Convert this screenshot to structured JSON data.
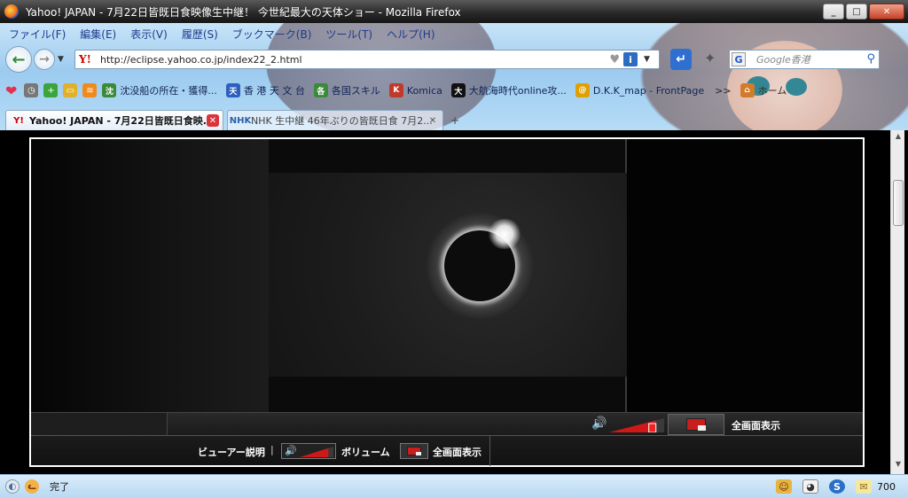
{
  "window": {
    "title": "Yahoo! JAPAN - 7月22日皆既日食映像生中継！ 今世紀最大の天体ショー - Mozilla Firefox",
    "minimize_glyph": "_",
    "maximize_glyph": "□",
    "close_glyph": "✕"
  },
  "menu": [
    "ファイル(F)",
    "編集(E)",
    "表示(V)",
    "履歴(S)",
    "ブックマーク(B)",
    "ツール(T)",
    "ヘルプ(H)"
  ],
  "nav": {
    "back_glyph": "←",
    "forward_glyph": "→",
    "url": "http://eclipse.yahoo.co.jp/index22_2.html",
    "search_placeholder": "Google香港",
    "search_engine_glyph": "G",
    "info_glyph": "i"
  },
  "bookmarks": {
    "items": [
      {
        "label": "沈没船の所在・獲得...",
        "icon": "ship-icon",
        "color": "#3b8a3b",
        "glyph": "沈"
      },
      {
        "label": "香 港 天 文 台",
        "icon": "observatory-icon",
        "color": "#2d5fbf",
        "glyph": "天"
      },
      {
        "label": "各国スキル",
        "icon": "skill-icon",
        "color": "#3b8a3b",
        "glyph": "各"
      },
      {
        "label": "Komica",
        "icon": "komica-icon",
        "color": "#c0392b",
        "glyph": "K"
      },
      {
        "label": "大航海時代online攻...",
        "icon": "voyage-icon",
        "color": "#111111",
        "glyph": "大"
      },
      {
        "label": "D.K.K_map - FrontPage",
        "icon": "map-icon",
        "color": "#e0a000",
        "glyph": "@"
      }
    ],
    "more": ">>",
    "home_label": "ホーム"
  },
  "tabs": [
    {
      "label": "Yahoo! JAPAN - 7月22日皆既日食映...",
      "favicon": "Y!",
      "favcolor": "#cc0000",
      "active": true
    },
    {
      "label": "NHK 生中継 46年ぶりの皆既日食 7月2...",
      "favicon": "NHK",
      "favcolor": "#2a5fa8",
      "active": false
    }
  ],
  "newtab_glyph": "+",
  "player": {
    "speaker_glyph": "🔊",
    "fullscreen_label": "全画面表示",
    "viewer_help_label": "ビューアー説明",
    "separator": "|",
    "volume_label": "ボリューム",
    "volume_level": 0.85,
    "accent_color": "#d01818"
  },
  "status": {
    "text": "完了",
    "mail_count": "700"
  }
}
